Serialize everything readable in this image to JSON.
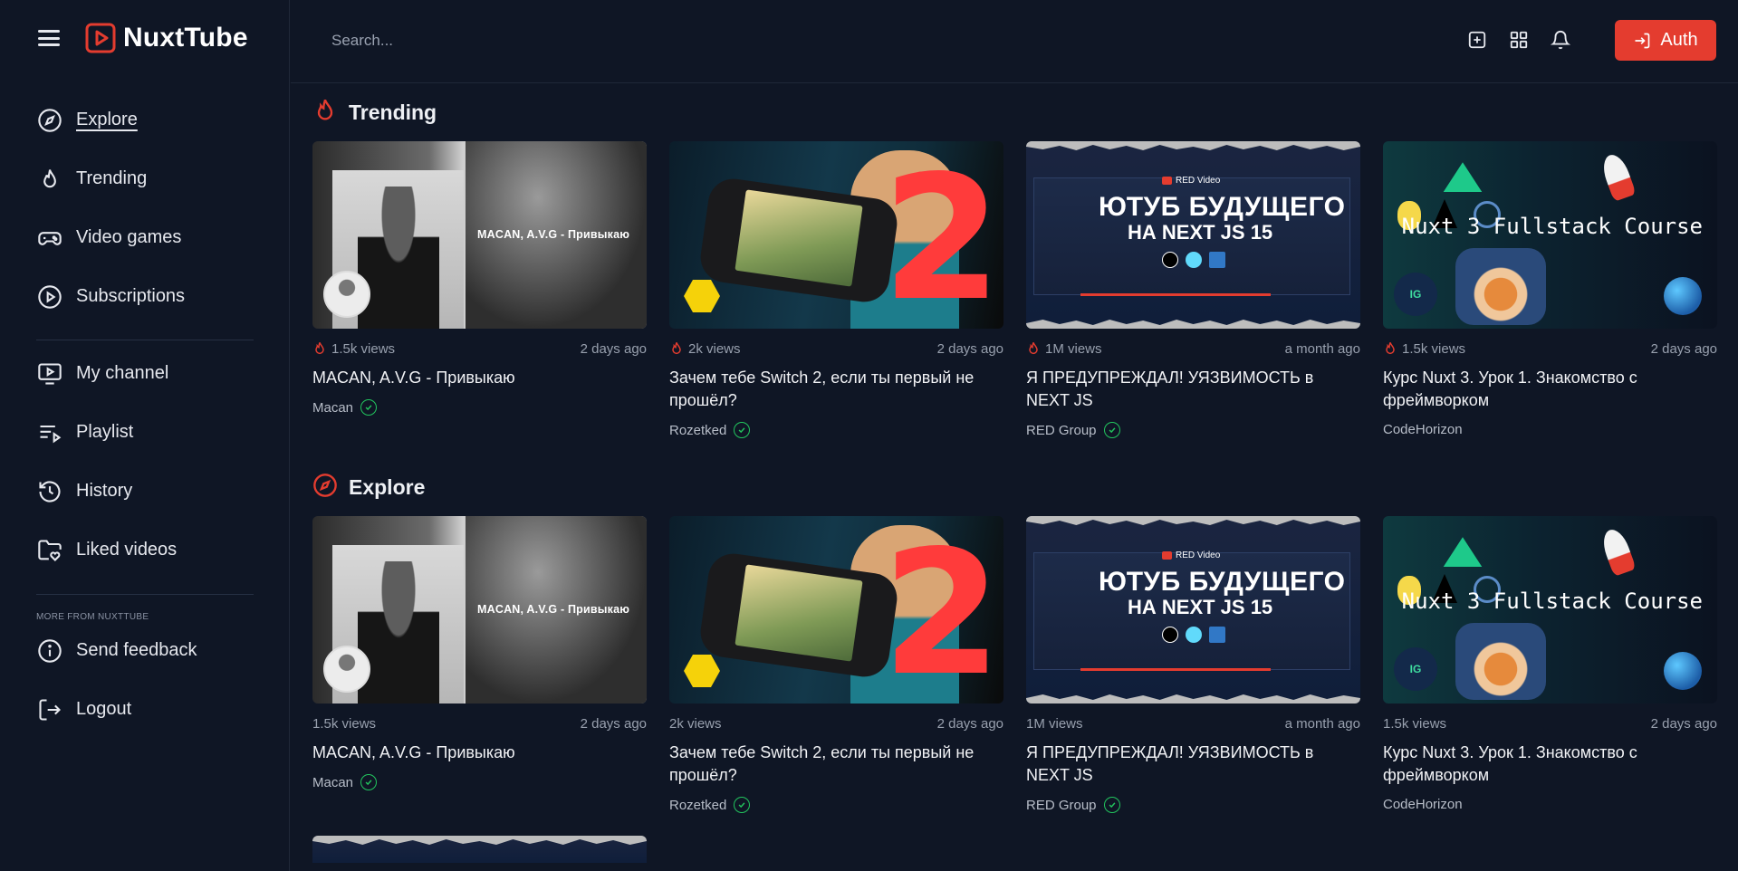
{
  "app": {
    "name": "NuxtTube"
  },
  "header": {
    "search_placeholder": "Search...",
    "icons": [
      "plus-square-icon",
      "grid-icon",
      "bell-icon"
    ],
    "auth_label": "Auth"
  },
  "sidebar": {
    "main": [
      {
        "label": "Explore",
        "icon": "compass-icon",
        "active": true
      },
      {
        "label": "Trending",
        "icon": "flame-icon"
      },
      {
        "label": "Video games",
        "icon": "gamepad-icon"
      },
      {
        "label": "Subscriptions",
        "icon": "play-circle-icon"
      }
    ],
    "library": [
      {
        "label": "My channel",
        "icon": "monitor-play-icon"
      },
      {
        "label": "Playlist",
        "icon": "list-play-icon"
      },
      {
        "label": "History",
        "icon": "history-icon"
      },
      {
        "label": "Liked videos",
        "icon": "folder-heart-icon"
      }
    ],
    "more_caption": "MORE FROM NUXTTUBE",
    "more": [
      {
        "label": "Send feedback",
        "icon": "info-icon"
      },
      {
        "label": "Logout",
        "icon": "logout-icon"
      }
    ]
  },
  "sections": [
    {
      "title": "Trending",
      "icon": "flame-icon",
      "videos": [
        {
          "views": "1.5k views",
          "date": "2 days ago",
          "title": "MACAN, A.V.G - Привыкаю",
          "channel": "Macan",
          "verified": true,
          "thumb_text": "MACAN, A.V.G - Привыкаю",
          "hot": true
        },
        {
          "views": "2k views",
          "date": "2 days ago",
          "title": "Зачем тебе Switch 2, если ты первый не прошёл?",
          "channel": "Rozetked",
          "verified": true,
          "thumb_text": "2",
          "hot": true
        },
        {
          "views": "1M views",
          "date": "a month ago",
          "title": "Я ПРЕДУПРЕЖДАЛ! УЯЗВИМОСТЬ в NEXT JS",
          "channel": "RED Group",
          "verified": true,
          "thumb_text": "ЮТУБ БУДУЩЕГО",
          "thumb_sub": "НА NEXT JS 15",
          "thumb_brand": "RED Video",
          "hot": true
        },
        {
          "views": "1.5k views",
          "date": "2 days ago",
          "title": "Курс Nuxt 3. Урок 1. Знакомство с фреймворком",
          "channel": "CodeHorizon",
          "verified": false,
          "thumb_text": "Nuxt 3 Fullstack Course",
          "hot": true
        }
      ]
    },
    {
      "title": "Explore",
      "icon": "compass-icon",
      "videos": [
        {
          "views": "1.5k views",
          "date": "2 days ago",
          "title": "MACAN, A.V.G - Привыкаю",
          "channel": "Macan",
          "verified": true,
          "thumb_text": "MACAN, A.V.G - Привыкаю",
          "hot": false
        },
        {
          "views": "2k views",
          "date": "2 days ago",
          "title": "Зачем тебе Switch 2, если ты первый не прошёл?",
          "channel": "Rozetked",
          "verified": true,
          "thumb_text": "2",
          "hot": false
        },
        {
          "views": "1M views",
          "date": "a month ago",
          "title": "Я ПРЕДУПРЕЖДАЛ! УЯЗВИМОСТЬ в NEXT JS",
          "channel": "RED Group",
          "verified": true,
          "thumb_text": "ЮТУБ БУДУЩЕГО",
          "thumb_sub": "НА NEXT JS 15",
          "thumb_brand": "RED Video",
          "hot": false
        },
        {
          "views": "1.5k views",
          "date": "2 days ago",
          "title": "Курс Nuxt 3. Урок 1. Знакомство с фреймворком",
          "channel": "CodeHorizon",
          "verified": false,
          "thumb_text": "Nuxt 3 Fullstack Course",
          "hot": false
        }
      ]
    }
  ],
  "colors": {
    "background": "#0f1625",
    "accent": "#e43c2f",
    "verified": "#22c55e"
  }
}
